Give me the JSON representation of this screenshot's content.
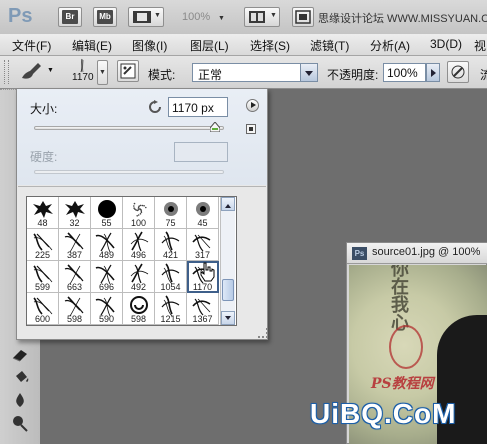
{
  "app_bar": {
    "logo": "Ps",
    "bridge": "Br",
    "minibridge": "Mb",
    "zoom": "100%",
    "site_text": "思缘设计论坛 WWW.MISSYUAN.COM"
  },
  "menu": {
    "items": [
      "文件(F)",
      "编辑(E)",
      "图像(I)",
      "图层(L)",
      "选择(S)",
      "滤镜(T)",
      "分析(A)",
      "3D(D)",
      "视"
    ]
  },
  "options_bar": {
    "brush_size_preview": "1170",
    "mode_label": "模式:",
    "mode_value": "正常",
    "opacity_label": "不透明度:",
    "opacity_value": "100%",
    "flow_label_partial": "流"
  },
  "brush_panel": {
    "size_label": "大小:",
    "size_value": "1170 px",
    "size_fraction": 0.95,
    "hardness_label": "硬度:",
    "brushes": [
      {
        "size": "48",
        "kind": "splat"
      },
      {
        "size": "32",
        "kind": "splat"
      },
      {
        "size": "55",
        "kind": "hard"
      },
      {
        "size": "100",
        "kind": "scatter"
      },
      {
        "size": "75",
        "kind": "soft"
      },
      {
        "size": "45",
        "kind": "soft"
      },
      {
        "size": "225",
        "kind": "hair"
      },
      {
        "size": "387",
        "kind": "hair"
      },
      {
        "size": "489",
        "kind": "hair"
      },
      {
        "size": "496",
        "kind": "hair"
      },
      {
        "size": "421",
        "kind": "hair"
      },
      {
        "size": "317",
        "kind": "hair"
      },
      {
        "size": "599",
        "kind": "hair"
      },
      {
        "size": "663",
        "kind": "hair"
      },
      {
        "size": "696",
        "kind": "hair"
      },
      {
        "size": "492",
        "kind": "hair"
      },
      {
        "size": "1054",
        "kind": "hair"
      },
      {
        "size": "1170",
        "kind": "hair",
        "selected": true
      },
      {
        "size": "600",
        "kind": "hair"
      },
      {
        "size": "598",
        "kind": "hair"
      },
      {
        "size": "590",
        "kind": "hair"
      },
      {
        "size": "598",
        "kind": "swirl"
      },
      {
        "size": "1215",
        "kind": "hair"
      },
      {
        "size": "1367",
        "kind": "hair"
      }
    ]
  },
  "document": {
    "title": "source01.jpg @ 100%",
    "icon": "Ps",
    "image_text": "你在我心",
    "image_caption": "PS教程网"
  },
  "watermark": "UiBQ.CoM"
}
